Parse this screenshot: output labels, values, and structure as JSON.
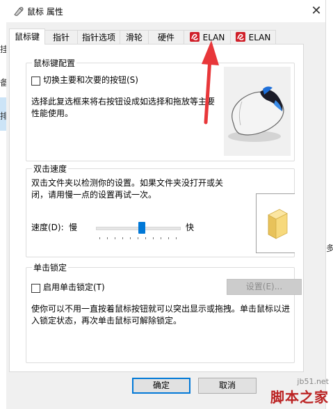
{
  "window": {
    "title": "鼠标 属性"
  },
  "background": {
    "left_chars": [
      "挂",
      "备",
      "排"
    ],
    "right_chars": [
      "多"
    ]
  },
  "tabs": [
    {
      "label": "鼠标键"
    },
    {
      "label": "指针"
    },
    {
      "label": "指针选项"
    },
    {
      "label": "滑轮"
    },
    {
      "label": "硬件"
    },
    {
      "label": "ELAN"
    },
    {
      "label": "ELAN"
    }
  ],
  "button_config": {
    "title": "鼠标键配置",
    "checkbox_label": "切换主要和次要的按钮(S)",
    "checked": false,
    "description_line1": "选择此复选框来将右按钮设成如选择和拖放等主要",
    "description_line2": "性能使用。"
  },
  "double_click": {
    "title": "双击速度",
    "description_line1": "双击文件夹以检测你的设置。如果文件夹没打开或关",
    "description_line2": "闭，请用慢一点的设置再试一次。",
    "speed_label": "速度(D):",
    "slow_label": "慢",
    "fast_label": "快",
    "speed_value": 0.55
  },
  "click_lock": {
    "title": "单击锁定",
    "checkbox_label": "启用单击锁定(T)",
    "checked": false,
    "settings_button": "设置(E)...",
    "description_line1": "使你可以不用一直按着鼠标按钮就可以突出显示或拖拽。单击鼠标以进",
    "description_line2": "入锁定状态，再次单击鼠标可解除锁定。"
  },
  "footer": {
    "ok_label": "确定",
    "cancel_label": "取消"
  },
  "watermark": {
    "url": "jb51.net",
    "name": "脚本之家"
  },
  "colors": {
    "accent": "#0078d7",
    "annotation_arrow": "#e8373a",
    "elan_icon": "#d0202a"
  }
}
